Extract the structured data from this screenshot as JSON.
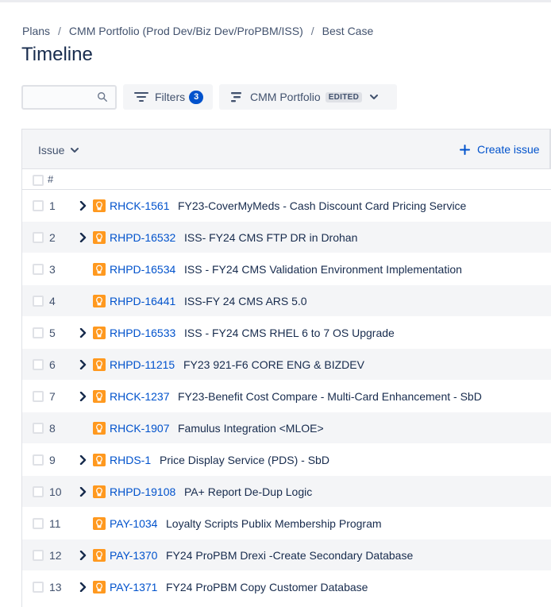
{
  "breadcrumb": [
    "Plans",
    "CMM Portfolio (Prod Dev/Biz Dev/ProPBM/ISS)",
    "Best Case"
  ],
  "breadcrumb_separator": "/",
  "page_title": "Timeline",
  "search": {
    "value": "",
    "placeholder": ""
  },
  "filters": {
    "label": "Filters",
    "count": "3"
  },
  "view": {
    "label": "CMM Portfolio",
    "badge": "EDITED"
  },
  "table": {
    "issue_header": "Issue",
    "create_issue": "Create issue",
    "hash_header": "#",
    "rows": [
      {
        "num": "1",
        "key": "RHCK-1561",
        "summary": "FY23-CoverMyMeds - Cash Discount Card Pricing Service",
        "expandable": true
      },
      {
        "num": "2",
        "key": "RHPD-16532",
        "summary": "ISS- FY24 CMS FTP DR in Drohan",
        "expandable": true
      },
      {
        "num": "3",
        "key": "RHPD-16534",
        "summary": "ISS - FY24 CMS Validation Environment Implementation",
        "expandable": false
      },
      {
        "num": "4",
        "key": "RHPD-16441",
        "summary": "ISS-FY 24 CMS ARS 5.0",
        "expandable": false
      },
      {
        "num": "5",
        "key": "RHPD-16533",
        "summary": "ISS - FY24 CMS RHEL 6 to 7 OS Upgrade",
        "expandable": true
      },
      {
        "num": "6",
        "key": "RHPD-11215",
        "summary": "FY23 921-F6 CORE ENG & BIZDEV",
        "expandable": true
      },
      {
        "num": "7",
        "key": "RHCK-1237",
        "summary": "FY23-Benefit Cost Compare - Multi-Card Enhancement - SbD",
        "expandable": true
      },
      {
        "num": "8",
        "key": "RHCK-1907",
        "summary": "Famulus Integration <MLOE>",
        "expandable": false
      },
      {
        "num": "9",
        "key": "RHDS-1",
        "summary": "Price Display Service (PDS) - SbD",
        "expandable": true
      },
      {
        "num": "10",
        "key": "RHPD-19108",
        "summary": "PA+ Report De-Dup Logic",
        "expandable": true
      },
      {
        "num": "11",
        "key": "PAY-1034",
        "summary": "Loyalty Scripts Publix Membership Program",
        "expandable": false
      },
      {
        "num": "12",
        "key": "PAY-1370",
        "summary": "FY24 ProPBM Drexi -Create Secondary Database",
        "expandable": true
      },
      {
        "num": "13",
        "key": "PAY-1371",
        "summary": "FY24 ProPBM Copy Customer Database",
        "expandable": true
      }
    ]
  },
  "colors": {
    "link": "#0052cc",
    "issue_type": "#ff991f",
    "row_alt": "#f4f5f7",
    "badge": "#0052cc"
  },
  "icons": {
    "search": "search-icon",
    "filter": "filter-icon",
    "view": "hierarchy-icon",
    "chevron": "chevron-down-icon",
    "plus": "plus-icon",
    "expand": "chevron-right-icon",
    "issue_type": "epic-icon"
  }
}
